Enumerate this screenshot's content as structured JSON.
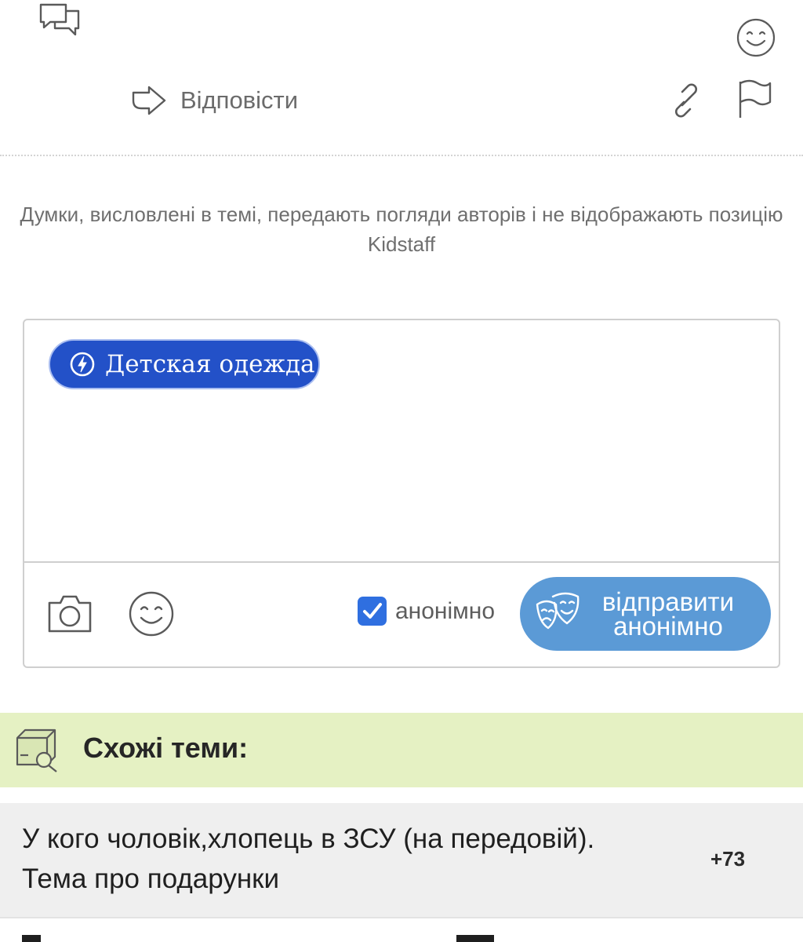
{
  "actions": {
    "reply_label": "Відповісти"
  },
  "disclaimer": {
    "text": "Думки, висловлені в темі, передають погляди авторів і не відображають позицію Kidstaff"
  },
  "composer": {
    "tag_label": "Детская одежда",
    "anonymous_label": "анонімно",
    "anonymous_checked": true,
    "send_label_line1": "відправити",
    "send_label_line2": "анонімно",
    "accent_color": "#2351c8",
    "send_color": "#5b9ad6",
    "checkbox_color": "#2f6fe0"
  },
  "related": {
    "title": "Схожі теми:",
    "header_color": "#e5f1c3",
    "topics": [
      {
        "title": "У кого чоловік,хлопець в ЗСУ (на передовій). Тема про подарунки",
        "count": "+73"
      }
    ]
  },
  "icons": {
    "comments": "speech-bubbles-icon",
    "reaction": "smile-icon",
    "reply": "reply-arrow-icon",
    "link": "link-icon",
    "report": "flag-icon",
    "tag": "lightning-bolt-icon",
    "attach_photo": "camera-icon",
    "emoji": "smile-icon",
    "anonymous": "theater-masks-icon",
    "related": "box-search-icon"
  }
}
